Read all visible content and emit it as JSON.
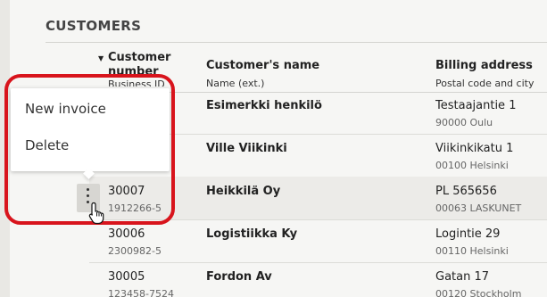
{
  "page": {
    "title": "CUSTOMERS"
  },
  "columns": {
    "number_label": "Customer number",
    "number_sub": "Business ID",
    "name_label": "Customer's name",
    "name_sub": "Name (ext.)",
    "address_label": "Billing address",
    "address_sub": "Postal code and city"
  },
  "context_menu": {
    "items": [
      {
        "label": "New invoice"
      },
      {
        "label": "Delete"
      }
    ]
  },
  "rows": [
    {
      "number": "",
      "business_id": "",
      "name": "Esimerkki henkilö",
      "street": "Testaajantie 1",
      "city": "90000 Oulu"
    },
    {
      "number": "",
      "business_id": "",
      "name": "Ville Viikinki",
      "street": "Viikinkikatu 1",
      "city": "00100 Helsinki"
    },
    {
      "number": "30007",
      "business_id": "1912266-5",
      "name": "Heikkilä Oy",
      "street": "PL 565656",
      "city": "00063 LASKUNET"
    },
    {
      "number": "30006",
      "business_id": "2300982-5",
      "name": "Logistiikka Ky",
      "street": "Logintie 29",
      "city": "00110 Helsinki"
    },
    {
      "number": "30005",
      "business_id": "123458-7524",
      "name": "Fordon Av",
      "street": "Gatan 17",
      "city": "00120 Stockholm"
    }
  ],
  "colors": {
    "highlight_ring": "#d8141c",
    "selected_row": "#ecebe8",
    "more_button": "#d7d6d2"
  },
  "icons": {
    "sort": "caret-down-icon",
    "more": "vertical-ellipsis-icon",
    "cursor": "hand-pointer-icon"
  }
}
